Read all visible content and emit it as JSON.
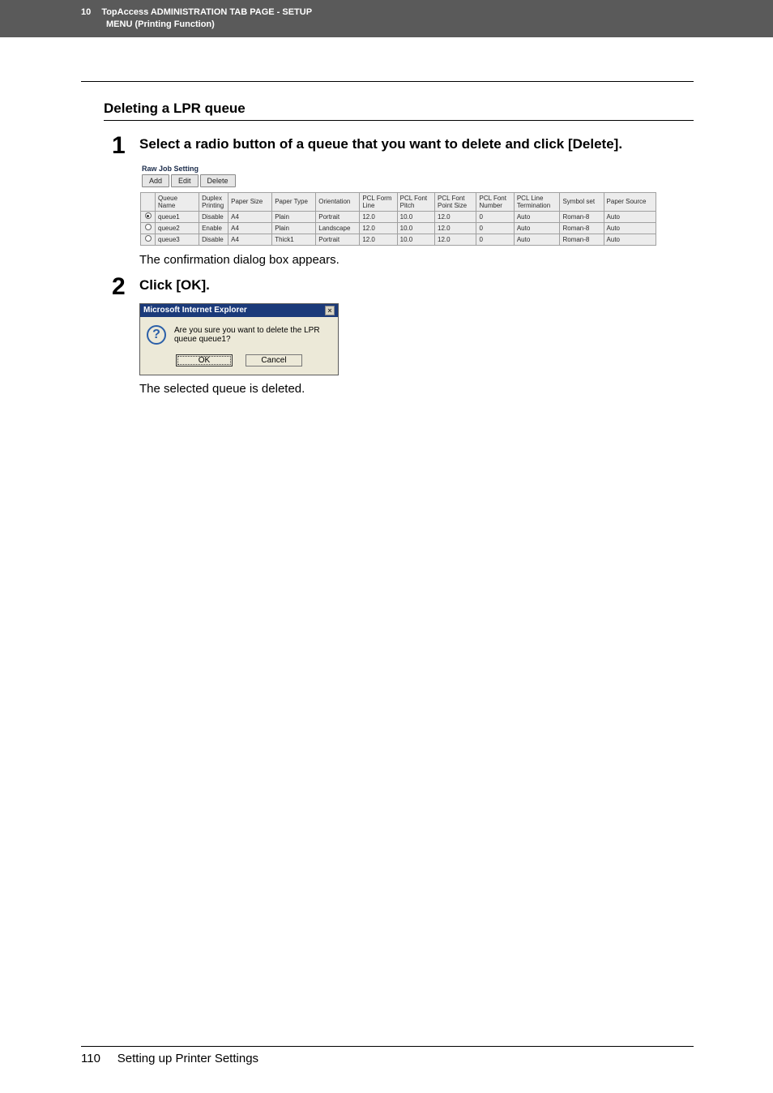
{
  "header": {
    "chapter_number": "10",
    "title_line1": "TopAccess ADMINISTRATION TAB PAGE - SETUP",
    "title_line2": "MENU (Printing Function)"
  },
  "section": {
    "title": "Deleting a LPR queue"
  },
  "steps": [
    {
      "number": "1",
      "title": "Select a radio button of a queue that you want to delete and click [Delete].",
      "caption": "The confirmation dialog box appears."
    },
    {
      "number": "2",
      "title": "Click [OK].",
      "caption": "The selected queue is deleted."
    }
  ],
  "rawjob": {
    "title": "Raw Job Setting",
    "buttons": {
      "add": "Add",
      "edit": "Edit",
      "delete": "Delete"
    },
    "columns": [
      "Queue Name",
      "Duplex Printing",
      "Paper Size",
      "Paper Type",
      "Orientation",
      "PCL Form Line",
      "PCL Font Pitch",
      "PCL Font Point Size",
      "PCL Font Number",
      "PCL Line Termination",
      "Symbol set",
      "Paper Source"
    ],
    "rows": [
      {
        "selected": true,
        "cells": [
          "queue1",
          "Disable",
          "A4",
          "Plain",
          "Portrait",
          "12.0",
          "10.0",
          "12.0",
          "0",
          "Auto",
          "Roman-8",
          "Auto"
        ]
      },
      {
        "selected": false,
        "cells": [
          "queue2",
          "Enable",
          "A4",
          "Plain",
          "Landscape",
          "12.0",
          "10.0",
          "12.0",
          "0",
          "Auto",
          "Roman-8",
          "Auto"
        ]
      },
      {
        "selected": false,
        "cells": [
          "queue3",
          "Disable",
          "A4",
          "Thick1",
          "Portrait",
          "12.0",
          "10.0",
          "12.0",
          "0",
          "Auto",
          "Roman-8",
          "Auto"
        ]
      }
    ]
  },
  "dialog": {
    "title": "Microsoft Internet Explorer",
    "message": "Are you sure you want to delete the LPR queue queue1?",
    "ok": "OK",
    "cancel": "Cancel"
  },
  "footer": {
    "page_number": "110",
    "section_name": "Setting up Printer Settings"
  }
}
